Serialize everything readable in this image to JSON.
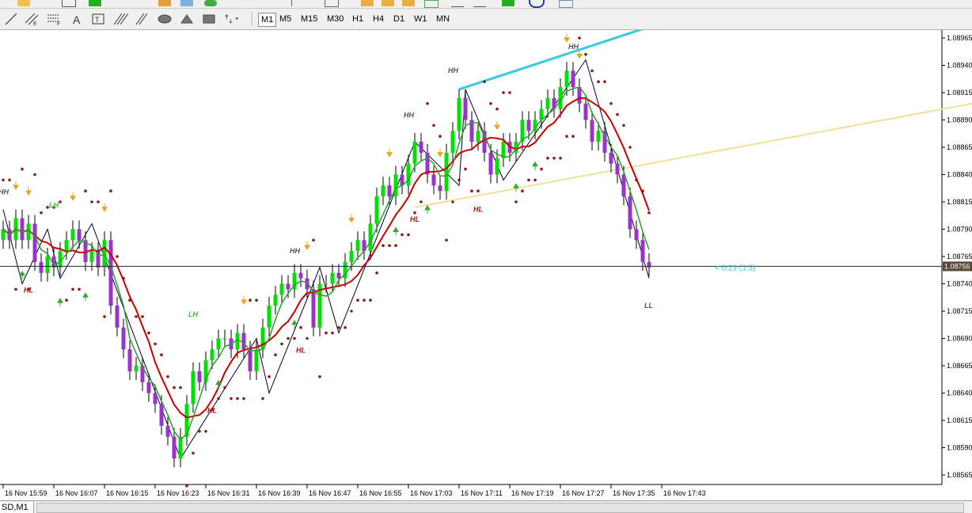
{
  "timeframes": [
    "M1",
    "M5",
    "M15",
    "M30",
    "H1",
    "H4",
    "D1",
    "W1",
    "MN"
  ],
  "active_timeframe": "M1",
  "status_tab": "SD,M1",
  "chart_data": {
    "type": "candlestick",
    "y_ticks": [
      "1.08965",
      "1.08940",
      "1.08915",
      "1.08890",
      "1.08865",
      "1.08840",
      "1.08815",
      "1.08790",
      "1.08765",
      "1.08740",
      "1.08715",
      "1.08690",
      "1.08665",
      "1.08640",
      "1.08615",
      "1.08590",
      "1.08565"
    ],
    "ylim": [
      1.08555,
      1.0898
    ],
    "x_ticks": [
      "16 Nov 15:59",
      "16 Nov 16:07",
      "16 Nov 16:15",
      "16 Nov 16:23",
      "16 Nov 16:31",
      "16 Nov 16:39",
      "16 Nov 16:47",
      "16 Nov 16:55",
      "16 Nov 17:03",
      "16 Nov 17:11",
      "16 Nov 17:19",
      "16 Nov 17:27",
      "16 Nov 17:35",
      "16 Nov 17:43"
    ],
    "current_price": "1.08756",
    "current_price_value": 1.08756,
    "annotation": "< 0.21 (1.3)",
    "colors": {
      "bull": "#00e000",
      "bear": "#9933cc",
      "ma_fast": "#2ca02c",
      "ma_slow": "#cc0000",
      "sar": "#8b1a1a",
      "zigzag": "#000033",
      "trend_blue": "#33ccdd",
      "trend_yellow": "#f0e09a",
      "up_arrow": "#33aa33",
      "down_arrow": "#f0a020"
    },
    "candle_times": [
      "15:59",
      "16:00",
      "16:01",
      "16:02",
      "16:03",
      "16:04",
      "16:05",
      "16:06",
      "16:07",
      "16:08",
      "16:09",
      "16:10",
      "16:11",
      "16:12",
      "16:13",
      "16:14",
      "16:15",
      "16:16",
      "16:17",
      "16:18",
      "16:19",
      "16:20",
      "16:21",
      "16:22",
      "16:23",
      "16:24",
      "16:25",
      "16:26",
      "16:27",
      "16:28",
      "16:29",
      "16:30",
      "16:31",
      "16:32",
      "16:33",
      "16:34",
      "16:35",
      "16:36",
      "16:37",
      "16:38",
      "16:39",
      "16:40",
      "16:41",
      "16:42",
      "16:43",
      "16:44",
      "16:45",
      "16:46",
      "16:47",
      "16:48",
      "16:49",
      "16:50",
      "16:51",
      "16:52",
      "16:53",
      "16:54",
      "16:55",
      "16:56",
      "16:57",
      "16:58",
      "16:59",
      "17:00",
      "17:01",
      "17:02",
      "17:03",
      "17:04",
      "17:05",
      "17:06",
      "17:07",
      "17:08",
      "17:09",
      "17:10",
      "17:11",
      "17:12",
      "17:13",
      "17:14",
      "17:15",
      "17:16",
      "17:17",
      "17:18",
      "17:19",
      "17:20",
      "17:21",
      "17:22",
      "17:23",
      "17:24",
      "17:25",
      "17:26",
      "17:27",
      "17:28",
      "17:29",
      "17:30",
      "17:31",
      "17:32",
      "17:33",
      "17:34",
      "17:35",
      "17:36",
      "17:37",
      "17:38",
      "17:39",
      "17:40",
      "17:41"
    ],
    "closes": [
      1.0879,
      1.0878,
      1.088,
      1.0878,
      1.08795,
      1.0876,
      1.0875,
      1.08765,
      1.08755,
      1.0877,
      1.0878,
      1.0879,
      1.0878,
      1.0876,
      1.0877,
      1.08755,
      1.0878,
      1.0872,
      1.087,
      1.0868,
      1.0866,
      1.08665,
      1.0865,
      1.0864,
      1.0863,
      1.0861,
      1.086,
      1.0858,
      1.086,
      1.0863,
      1.0866,
      1.0865,
      1.0867,
      1.0868,
      1.0869,
      1.0869,
      1.0868,
      1.08695,
      1.0868,
      1.0866,
      1.0868,
      1.087,
      1.0872,
      1.0873,
      1.0874,
      1.08735,
      1.0875,
      1.08745,
      1.08735,
      1.087,
      1.0874,
      1.0874,
      1.0875,
      1.08745,
      1.0876,
      1.0877,
      1.0878,
      1.0877,
      1.08795,
      1.0882,
      1.0883,
      1.0882,
      1.0884,
      1.0883,
      1.0885,
      1.0887,
      1.0886,
      1.0884,
      1.0883,
      1.08825,
      1.0886,
      1.0888,
      1.0891,
      1.0889,
      1.0887,
      1.0888,
      1.0886,
      1.0884,
      1.08855,
      1.0887,
      1.0886,
      1.0887,
      1.0889,
      1.0888,
      1.0889,
      1.089,
      1.0891,
      1.089,
      1.0892,
      1.08935,
      1.0892,
      1.08905,
      1.0889,
      1.0887,
      1.0888,
      1.0886,
      1.0885,
      1.0884,
      1.0882,
      1.0879,
      1.0878,
      1.0876,
      1.08755
    ],
    "labels": [
      {
        "text": "HH",
        "time": "15:59",
        "price": 1.08822,
        "color": "#555555"
      },
      {
        "text": "LH",
        "time": "16:07",
        "price": 1.0881,
        "color": "#33cc33"
      },
      {
        "text": "HL",
        "time": "16:03",
        "price": 1.08732,
        "color": "#cc0000"
      },
      {
        "text": "LH",
        "time": "16:29",
        "price": 1.0871,
        "color": "#33cc33"
      },
      {
        "text": "HL",
        "time": "16:32",
        "price": 1.08622,
        "color": "#cc0000"
      },
      {
        "text": "HH",
        "time": "16:45",
        "price": 1.08768,
        "color": "#555555"
      },
      {
        "text": "HL",
        "time": "16:46",
        "price": 1.08677,
        "color": "#cc0000"
      },
      {
        "text": "HH",
        "time": "17:03",
        "price": 1.08892,
        "color": "#555555"
      },
      {
        "text": "HL",
        "time": "17:04",
        "price": 1.08797,
        "color": "#cc0000"
      },
      {
        "text": "HH",
        "time": "17:10",
        "price": 1.08933,
        "color": "#555555"
      },
      {
        "text": "HL",
        "time": "17:14",
        "price": 1.08806,
        "color": "#cc0000"
      },
      {
        "text": "HH",
        "time": "17:29",
        "price": 1.08955,
        "color": "#555555"
      },
      {
        "text": "LL",
        "time": "17:41",
        "price": 1.08718,
        "color": "#555555"
      }
    ]
  }
}
